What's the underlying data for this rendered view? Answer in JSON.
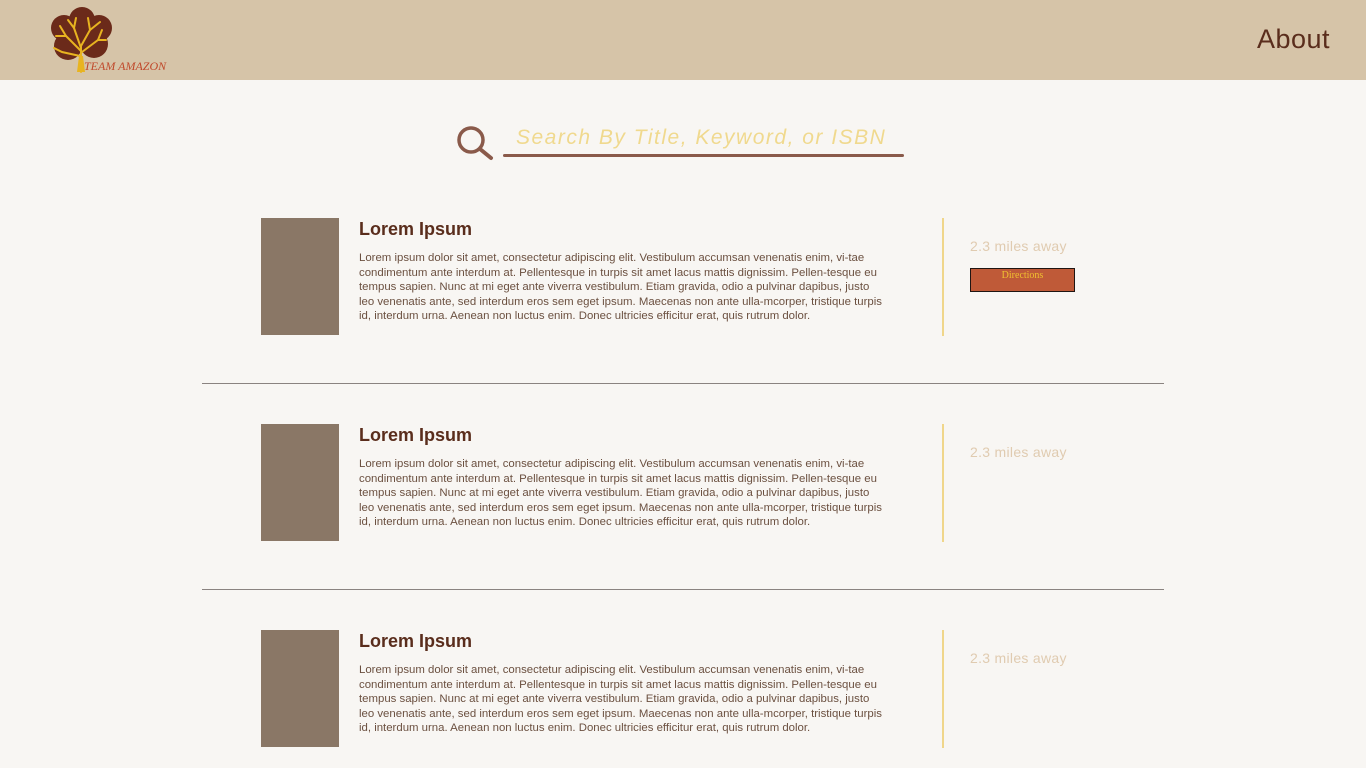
{
  "header": {
    "logo_text": "TEAM AMAZON",
    "about_label": "About"
  },
  "search": {
    "placeholder": "Search By Title, Keyword, or ISBN"
  },
  "results": [
    {
      "title": "Lorem Ipsum",
      "description": "Lorem ipsum dolor sit amet, consectetur adipiscing elit. Vestibulum accumsan venenatis enim, vi-tae condimentum ante interdum at. Pellentesque in turpis sit amet lacus mattis dignissim. Pellen-tesque eu tempus sapien. Nunc at mi eget ante viverra vestibulum. Etiam gravida, odio a pulvinar dapibus, justo leo venenatis ante, sed interdum eros sem eget ipsum. Maecenas non ante ulla-mcorper, tristique turpis id, interdum urna. Aenean non luctus enim. Donec ultricies efficitur erat, quis rutrum dolor.",
      "distance": "2.3 miles away",
      "directions_label": "Directions"
    },
    {
      "title": "Lorem Ipsum",
      "description": "Lorem ipsum dolor sit amet, consectetur adipiscing elit. Vestibulum accumsan venenatis enim, vi-tae condimentum ante interdum at. Pellentesque in turpis sit amet lacus mattis dignissim. Pellen-tesque eu tempus sapien. Nunc at mi eget ante viverra vestibulum. Etiam gravida, odio a pulvinar dapibus, justo leo venenatis ante, sed interdum eros sem eget ipsum. Maecenas non ante ulla-mcorper, tristique turpis id, interdum urna. Aenean non luctus enim. Donec ultricies efficitur erat, quis rutrum dolor.",
      "distance": "2.3 miles away"
    },
    {
      "title": "Lorem Ipsum",
      "description": "Lorem ipsum dolor sit amet, consectetur adipiscing elit. Vestibulum accumsan venenatis enim, vi-tae condimentum ante interdum at. Pellentesque in turpis sit amet lacus mattis dignissim. Pellen-tesque eu tempus sapien. Nunc at mi eget ante viverra vestibulum. Etiam gravida, odio a pulvinar dapibus, justo leo venenatis ante, sed interdum eros sem eget ipsum. Maecenas non ante ulla-mcorper, tristique turpis id, interdum urna. Aenean non luctus enim. Donec ultricies efficitur erat, quis rutrum dolor.",
      "distance": "2.3 miles away"
    }
  ],
  "colors": {
    "header_bg": "#d6c4a8",
    "accent_brown": "#5a2d1c",
    "thumb": "#8a7766",
    "search_placeholder": "#f0d98e",
    "directions_bg": "#bf5a38",
    "directions_text": "#f0c030"
  },
  "icons": {
    "logo": "tree-logo-icon",
    "search": "search-icon"
  }
}
